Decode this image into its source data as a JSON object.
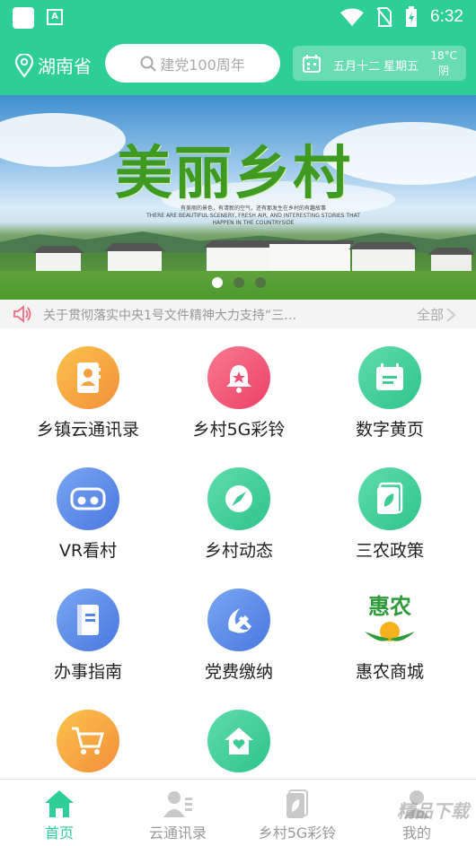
{
  "status_bar": {
    "time": "6:32",
    "app_badge": "A"
  },
  "header": {
    "location": "湖南省",
    "search_placeholder": "建党100周年",
    "date": "五月十二 星期五",
    "temperature": "18°C",
    "weather": "阴"
  },
  "banner": {
    "title": "美丽乡村",
    "subtitle": "有美丽的景色，有清新的空气，还有那发生在乡村的有趣故事",
    "subtitle_en": "THERE ARE BEAUTIFUL SCENERY, FRESH AIR, AND INTERESTING STORIES THAT HAPPEN IN THE COUNTRYSIDE",
    "slide_count": 3,
    "active_slide": 1
  },
  "notice": {
    "text": "关于贯彻落实中央1号文件精神大力支持“三…",
    "more_label": "全部"
  },
  "grid": [
    {
      "label": "乡镇云通讯录",
      "icon": "contacts-book-icon",
      "color": "orange"
    },
    {
      "label": "乡村5G彩铃",
      "icon": "bell-icon",
      "color": "pink"
    },
    {
      "label": "数字黄页",
      "icon": "calendar-page-icon",
      "color": "green"
    },
    {
      "label": "VR看村",
      "icon": "vr-glasses-icon",
      "color": "blue"
    },
    {
      "label": "乡村动态",
      "icon": "compass-icon",
      "color": "green"
    },
    {
      "label": "三农政策",
      "icon": "leaf-document-icon",
      "color": "green"
    },
    {
      "label": "办事指南",
      "icon": "guide-book-icon",
      "color": "blue"
    },
    {
      "label": "党费缴纳",
      "icon": "party-emblem-icon",
      "color": "blue"
    },
    {
      "label": "惠农商城",
      "icon": "huinong-logo-icon",
      "color": "none",
      "logo_text": "惠农"
    },
    {
      "label": "",
      "icon": "shopping-cart-icon",
      "color": "orange"
    },
    {
      "label": "",
      "icon": "home-heart-icon",
      "color": "green"
    }
  ],
  "tabbar": [
    {
      "label": "首页",
      "icon": "home-icon",
      "active": true
    },
    {
      "label": "云通讯录",
      "icon": "contacts-icon",
      "active": false
    },
    {
      "label": "乡村5G彩铃",
      "icon": "ringtone-icon",
      "active": false
    },
    {
      "label": "我的",
      "icon": "profile-icon",
      "active": false
    }
  ],
  "watermark": "精品下载",
  "colors": {
    "brand": "#2ecf96",
    "notice_bg": "#f4f4f4"
  }
}
